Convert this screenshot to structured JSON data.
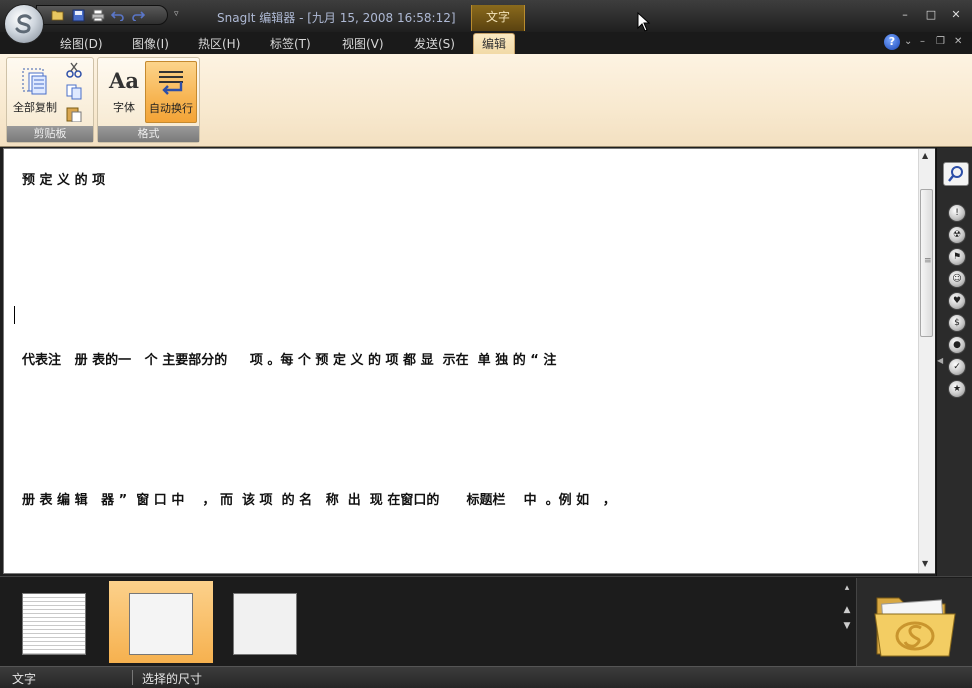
{
  "window": {
    "title": "SnagIt 编辑器 - [九月 15, 2008 16:58:12]",
    "context_tab_title": "文字",
    "controls": {
      "minimize": "–",
      "maximize": "□",
      "close": "✕"
    }
  },
  "ribbon_tabs": [
    {
      "label": "绘图(D)",
      "active": false
    },
    {
      "label": "图像(I)",
      "active": false
    },
    {
      "label": "热区(H)",
      "active": false
    },
    {
      "label": "标签(T)",
      "active": false
    },
    {
      "label": "视图(V)",
      "active": false
    },
    {
      "label": "发送(S)",
      "active": false
    },
    {
      "label": "编辑",
      "active": true
    }
  ],
  "help": {
    "label": "?"
  },
  "ribbon": {
    "clipboard_group": {
      "label": "剪贴板",
      "copy_all": "全部复制",
      "icons": [
        "scissors-icon",
        "copy-icon",
        "paste-icon"
      ]
    },
    "format_group": {
      "label": "格式",
      "font": "字体",
      "font_glyph": "Aa",
      "word_wrap": "自动换行",
      "word_wrap_pressed": true
    }
  },
  "editor": {
    "lines": [
      "预 定 义 的 项",
      "代表注   册 表的一   个 主要部分的     项 。每 个 预 定 义 的 项 都 显  示在  单 独 的 “ 注",
      "册 表 编 辑   器 ”  窗 口 中    ， 而  该 项  的 名   称  出  现 在窗口的      标题栏    中  。例 如   ，"
    ]
  },
  "stamps": [
    "search-icon",
    "warning-icon",
    "radiation-icon",
    "flag-icon",
    "smiley-icon",
    "heart-icon",
    "dollar-icon",
    "bulb-icon",
    "check-icon",
    "star-icon"
  ],
  "tray": {
    "thumbnails": [
      "capture-1",
      "capture-2",
      "capture-3"
    ],
    "selected_index": 1
  },
  "statusbar": {
    "left": "文字",
    "right": "选择的尺寸"
  },
  "colors": {
    "ribbon_bg": "#f8e9cf",
    "active_tab": "#f1d9a6",
    "pressed_button": "#f7b553",
    "title_text": "#aeb9d4"
  }
}
